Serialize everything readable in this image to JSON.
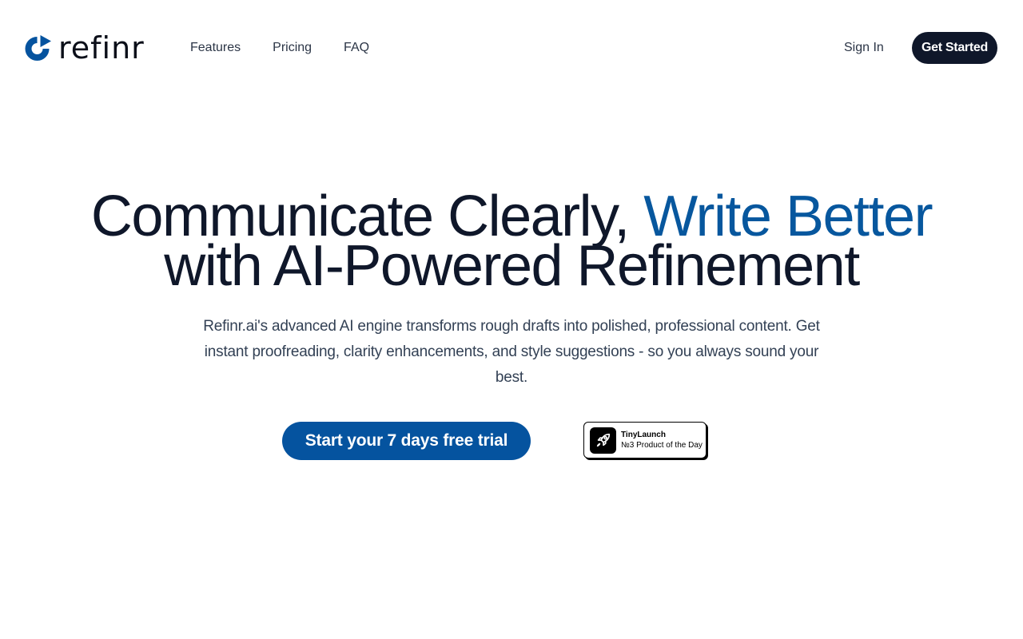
{
  "header": {
    "logo_text": "refinr",
    "nav": [
      {
        "label": "Features"
      },
      {
        "label": "Pricing"
      },
      {
        "label": "FAQ"
      }
    ],
    "sign_in": "Sign In",
    "get_started": "Get Started"
  },
  "hero": {
    "title_part1": "Communicate Clearly, ",
    "title_accent": "Write Better",
    "title_part2": "with AI-Powered Refinement",
    "subtitle": "Refinr.ai's advanced AI engine transforms rough drafts into polished, professional content. Get instant proofreading, clarity enhancements, and style suggestions - so you always sound your best.",
    "cta": "Start your 7 days free trial"
  },
  "badge": {
    "icon": "rocket-icon",
    "name": "TinyLaunch",
    "caption": "№3 Product of the Day"
  },
  "colors": {
    "brand_blue": "#05539f",
    "accent_text": "#07579e",
    "dark_button": "#0f172a",
    "heading": "#0f172a",
    "body_text": "#334155"
  }
}
